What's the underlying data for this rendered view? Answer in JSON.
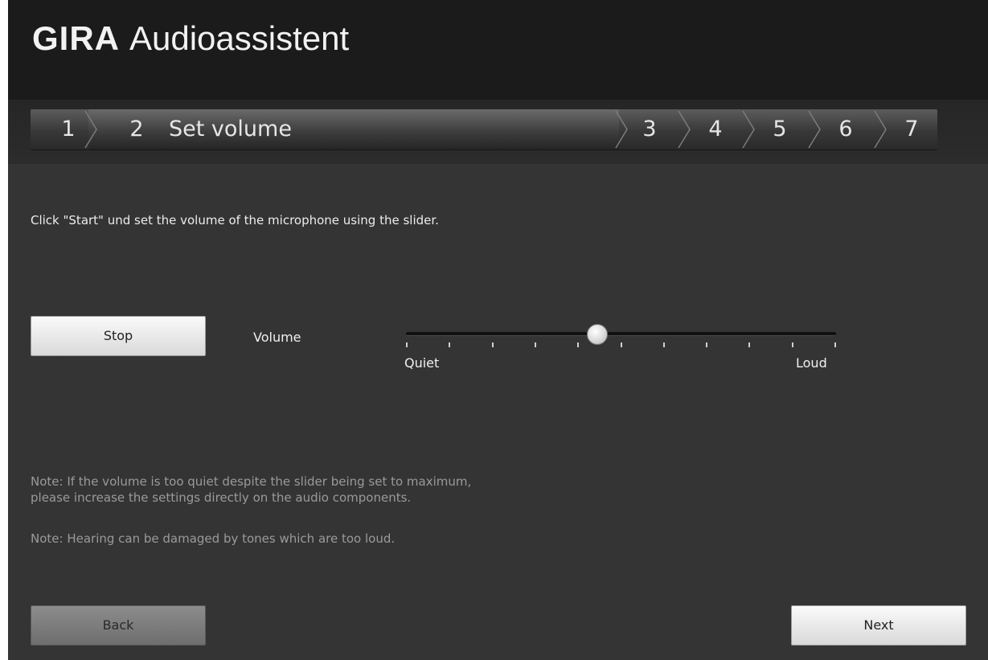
{
  "header": {
    "logo": "GIRA",
    "title": "Audioassistent"
  },
  "steps": [
    {
      "number": "1"
    },
    {
      "number": "2",
      "label": "Set volume",
      "active": true
    },
    {
      "number": "3"
    },
    {
      "number": "4"
    },
    {
      "number": "5"
    },
    {
      "number": "6"
    },
    {
      "number": "7"
    }
  ],
  "instruction": "Click \"Start\" und set the volume of the microphone using the slider.",
  "controls": {
    "stop_label": "Stop",
    "volume_label": "Volume",
    "slider_min_label": "Quiet",
    "slider_max_label": "Loud",
    "slider_value_fraction": 0.445,
    "tick_count": 11
  },
  "notes": {
    "note1_line1": "Note: If the volume is too quiet despite the slider being set to maximum,",
    "note1_line2": "please increase the settings directly on the audio components.",
    "note2": "Note: Hearing can be damaged by tones which are too loud."
  },
  "footer": {
    "back_label": "Back",
    "next_label": "Next"
  },
  "colors": {
    "window_bg": "#343434",
    "titlebar_bg": "#1b1b1b",
    "note_text": "#9a9a9a"
  }
}
